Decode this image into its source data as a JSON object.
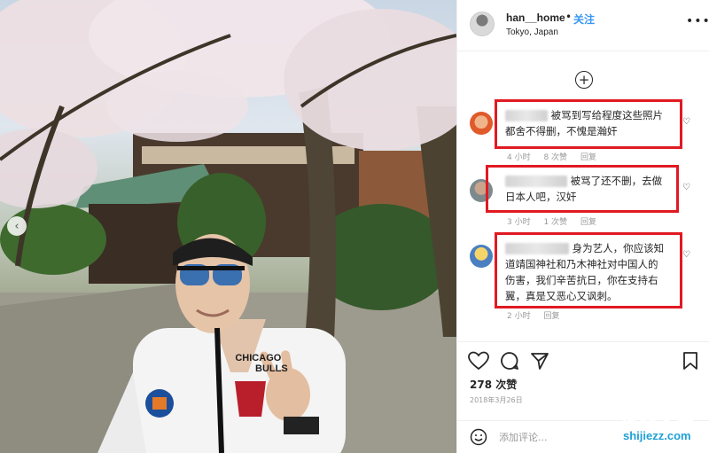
{
  "post": {
    "username": "han__home",
    "separator": "•",
    "follow_label": "关注",
    "location": "Tokyo, Japan",
    "more_icon": "more-horizontal-icon",
    "likes": "278 次赞",
    "date": "2018年3月26日",
    "add_comment_placeholder": "添加评论..."
  },
  "comments": [
    {
      "text_line1": "被骂到写给程度这些照片",
      "text_line2": "都舍不得删，不愧是瀚奸",
      "time": "4 小时",
      "likes": "8 次赞",
      "reply": "回复"
    },
    {
      "text_line1": "被骂了还不删，去做",
      "text_line2": "日本人吧，汉奸",
      "time": "3 小时",
      "likes": "1 次赞",
      "reply": "回复"
    },
    {
      "text_line1": "身为艺人，你应该知",
      "text_line2": "道靖国神社和乃木神社对中国人的",
      "text_line3": "伤害，我们辛苦抗日，你在支持右",
      "text_line4": "翼，真是又恶心又讽刺。",
      "time": "2 小时",
      "reply": "回复"
    }
  ],
  "jacket": {
    "brand_line1": "CHICAGO",
    "brand_line2": "BULLS"
  },
  "watermark": {
    "line1": "世界之最",
    "line2": "shijiezz.com"
  },
  "colors": {
    "highlight": "#e01a22",
    "follow": "#3897f0",
    "watermark": "#1ea0d8"
  }
}
